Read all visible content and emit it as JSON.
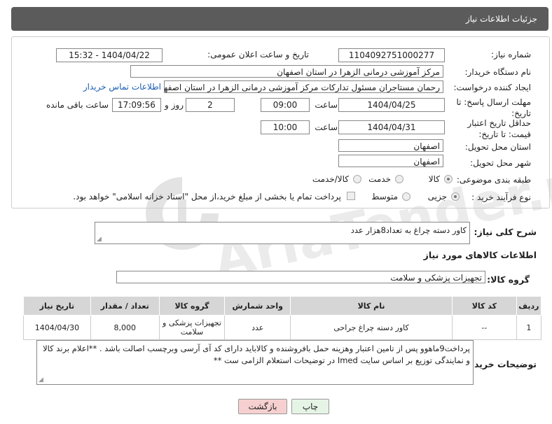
{
  "header": {
    "title": "جزئیات اطلاعات نیاز"
  },
  "form": {
    "need_number_label": "شماره نیاز:",
    "need_number": "1104092751000277",
    "announce_label": "تاریخ و ساعت اعلان عمومی:",
    "announce_value": "1404/04/22 - 15:32",
    "buyer_org_label": "نام دستگاه خریدار:",
    "buyer_org": "مرکز آموزشی درمانی الزهرا در استان اصفهان",
    "requester_label": "ایجاد کننده درخواست:",
    "requester": "رحمان مستاجران مسئول تدارکات مرکز آموزشی درمانی الزهرا در استان اصفهان",
    "contact_link": "اطلاعات تماس خریدار",
    "reply_deadline_label": "مهلت ارسال پاسخ: تا تاریخ:",
    "reply_date": "1404/04/25",
    "time_label": "ساعت",
    "reply_time": "09:00",
    "days_value": "2",
    "days_label": "روز و",
    "remaining_time": "17:09:56",
    "remaining_label": "ساعت باقی مانده",
    "price_deadline_label": "حداقل تاریخ اعتبار قیمت: تا تاریخ:",
    "price_date": "1404/04/31",
    "price_time": "10:00",
    "province_label": "استان محل تحویل:",
    "province": "اصفهان",
    "city_label": "شهر محل تحویل:",
    "city": "اصفهان",
    "category_label": "طبقه بندی موضوعی:",
    "category_options": [
      "کالا",
      "خدمت",
      "کالا/خدمت"
    ],
    "process_label": "نوع فرآیند خرید :",
    "process_options": [
      "جزیی",
      "متوسط"
    ],
    "payment_note": "پرداخت تمام یا بخشی از مبلغ خرید،از محل \"اسناد خزانه اسلامی\" خواهد بود."
  },
  "description": {
    "label": "شرح کلی نیاز:",
    "value": "کاور دسته چراغ به تعداد8هزار عدد"
  },
  "goods": {
    "section_title": "اطلاعات کالاهای مورد نیاز",
    "group_label": "گروه کالا:",
    "group_value": "تجهیزات پزشکی و سلامت",
    "columns": [
      "ردیف",
      "کد کالا",
      "نام کالا",
      "واحد شمارش",
      "گروه کالا",
      "تعداد / مقدار",
      "تاریخ نیاز"
    ],
    "rows": [
      [
        "1",
        "--",
        "کاور دسته چراغ جراحی",
        "عدد",
        "تجهیزات پزشکی و سلامت",
        "8,000",
        "1404/04/30"
      ]
    ]
  },
  "buyer_notes": {
    "label": "توضیحات خریدار:",
    "value": "پرداخت9ماهوو پس از تامین اعتبار وهزینه حمل بافروشنده و کالاباید دارای کد آی آرسی وبرچسب اصالت باشد . **اعلام برند کالا و نمایندگی توزیع بر اساس سایت Imed در توضیحات استعلام الزامی ست **"
  },
  "buttons": {
    "print": "چاپ",
    "back": "بازگشت"
  },
  "watermark": {
    "text": "AriaTender.net"
  },
  "colors": {
    "header_bg": "#5b5b5b",
    "link": "#1a5fb4",
    "back_button_bg": "#f6d0d0",
    "print_button_bg": "#e6f4e6"
  }
}
